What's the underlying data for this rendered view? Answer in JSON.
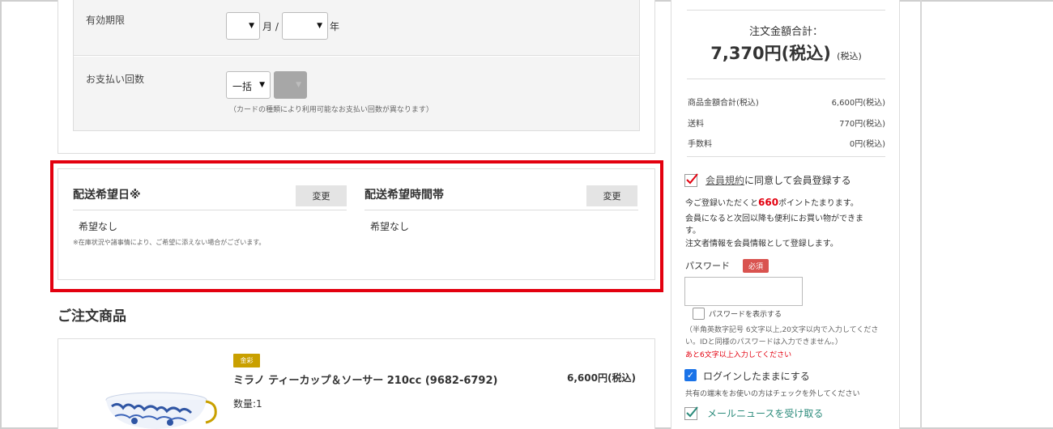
{
  "payment": {
    "expiry_label": "有効期限",
    "month_unit": "月 /",
    "year_unit": "年",
    "installments_label": "お支払い回数",
    "installments_value": "一括",
    "installments_note": "（カードの種類により利用可能なお支払い回数が異なります）"
  },
  "delivery": {
    "date_title": "配送希望日※",
    "date_change": "変更",
    "date_value": "希望なし",
    "date_note": "※在庫状況や諸事情により、ご希望に添えない場合がございます。",
    "time_title": "配送希望時間帯",
    "time_change": "変更",
    "time_value": "希望なし"
  },
  "order": {
    "heading": "ご注文商品",
    "badge": "金彩",
    "product_name": "ミラノ ティーカップ＆ソーサー 210cc (9682-6792)",
    "price": "6,600円(税込)",
    "quantity": "数量:1"
  },
  "summary": {
    "total_label": "注文金額合計：",
    "total_value": "7,370円(税込)",
    "total_suffix": "(税込)",
    "rows": [
      {
        "label": "商品金額合計(税込)",
        "value": "6,600円(税込)"
      },
      {
        "label": "送料",
        "value": "770円(税込)"
      },
      {
        "label": "手数料",
        "value": "0円(税込)"
      }
    ]
  },
  "register": {
    "terms_link": "会員規約",
    "terms_rest": "に同意して会員登録する",
    "points_pre": "今ご登録いただくと",
    "points_value": "660",
    "points_post": "ポイントたまります。",
    "benefit_line1": "会員になると次回以降も便利にお買い物ができま",
    "benefit_line2": "す。",
    "benefit_line3": "注文者情報を会員情報として登録します。",
    "password_label": "パスワード",
    "required_badge": "必須",
    "show_password": "パスワードを表示する",
    "password_hint": "（半角英数字記号 6文字以上,20文字以内で入力してください。IDと同様のパスワードは入力できません。）",
    "password_warning": "あと6文字以上入力してください",
    "stay_logged_in": "ログインしたままにする",
    "stay_note": "共有の端末をお使いの方はチェックを外してください",
    "newsletter": "メールニュースを受け取る"
  },
  "colors": {
    "highlight": "#e3000f",
    "accent_teal": "#2a8a7a",
    "checkbox_blue": "#1a73e8",
    "badge_gold": "#c9a000"
  }
}
